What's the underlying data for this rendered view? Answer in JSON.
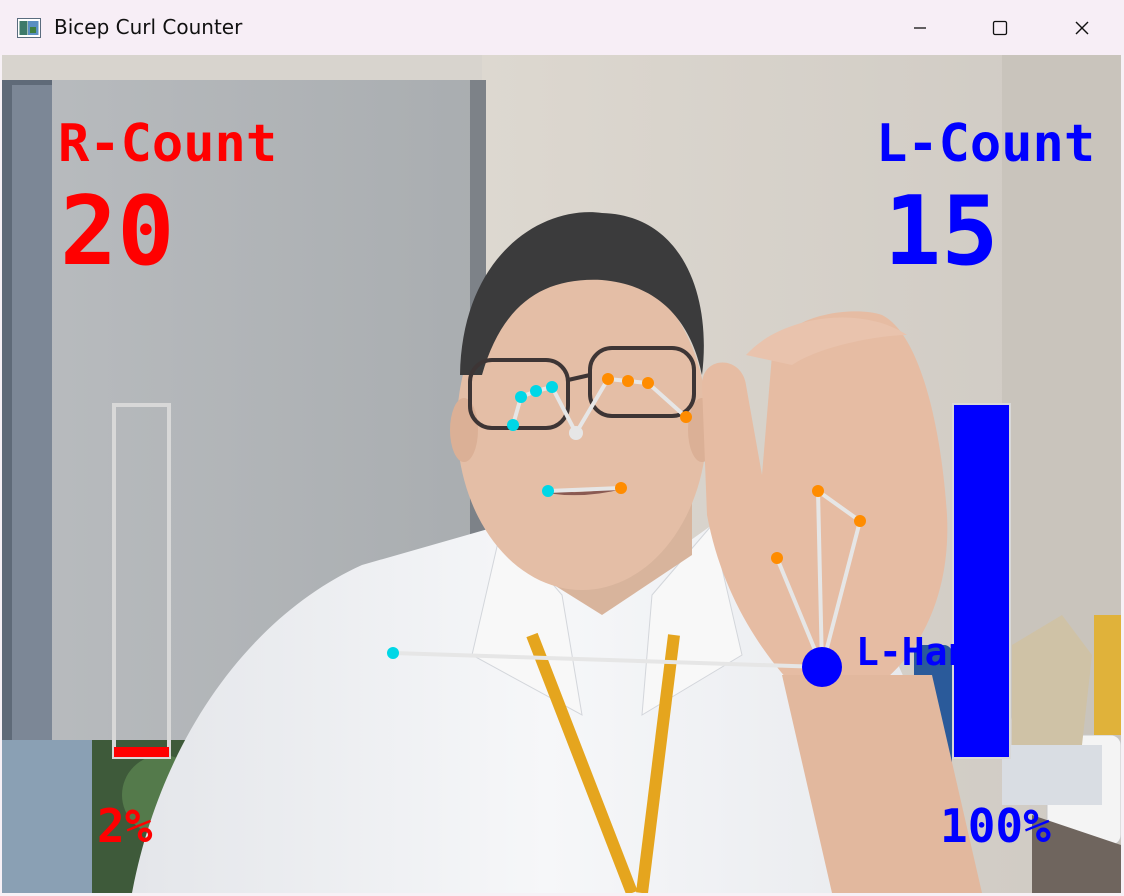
{
  "window": {
    "title": "Bicep Curl Counter",
    "controls": {
      "minimize": "minimize-icon",
      "maximize": "maximize-icon",
      "close": "close-icon"
    }
  },
  "overlay": {
    "right": {
      "label": "R-Count",
      "count": "20",
      "percent_text": "2%",
      "progress": 0.02,
      "color": "#ff0000"
    },
    "left": {
      "label": "L-Count",
      "count": "15",
      "percent_text": "100%",
      "progress": 1.0,
      "color": "#0000ff"
    },
    "hand_label": "L-Hand",
    "bar_outline_color": "#d8d8d8",
    "pose_colors": {
      "left_side": "#00d7e6",
      "right_side": "#ff8c00",
      "connector": "#e6e6e6"
    }
  }
}
